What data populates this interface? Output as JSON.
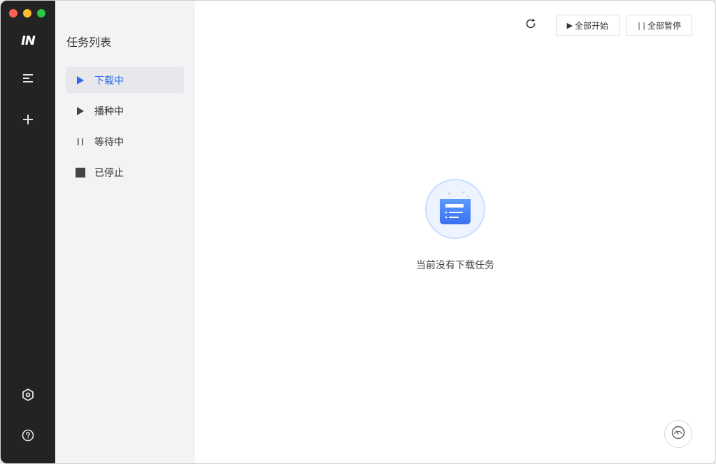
{
  "app": {
    "logo_text": "IN",
    "accent_color": "#2d6bf0",
    "rail_color": "#232323"
  },
  "rail": {
    "items": [
      {
        "name": "task-list",
        "icon": "list-icon"
      },
      {
        "name": "add-task",
        "icon": "plus-icon"
      }
    ],
    "bottom": [
      {
        "name": "settings",
        "icon": "settings-hexagon-icon"
      },
      {
        "name": "help",
        "icon": "help-circle-icon"
      }
    ]
  },
  "sidebar": {
    "title": "任务列表",
    "items": [
      {
        "label": "下载中",
        "icon": "play-icon",
        "active": true
      },
      {
        "label": "播种中",
        "icon": "play-icon",
        "active": false
      },
      {
        "label": "等待中",
        "icon": "pause-icon",
        "active": false
      },
      {
        "label": "已停止",
        "icon": "stop-icon",
        "active": false
      }
    ]
  },
  "toolbar": {
    "refresh_icon": "refresh-icon",
    "start_all_glyph": "▶",
    "start_all_label": "全部开始",
    "pause_all_glyph": "| |",
    "pause_all_label": "全部暂停"
  },
  "main": {
    "empty_icon": "empty-task-icon",
    "empty_text": "当前没有下载任务",
    "speed_icon": "speedometer-icon"
  }
}
